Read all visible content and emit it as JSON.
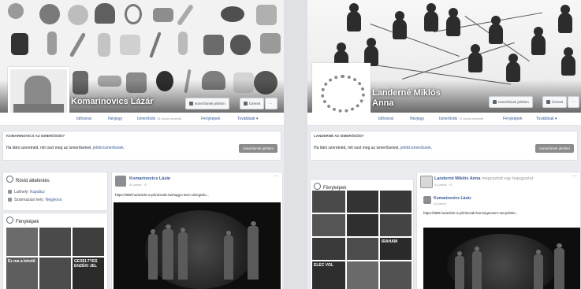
{
  "left": {
    "profile_name": "Komarinovics Lázár",
    "buttons": {
      "friend_request": "Ismerősnek jelölöm",
      "message": "Üzenet"
    },
    "nav": [
      {
        "label": "Idővonal",
        "sub": ""
      },
      {
        "label": "Névjegy",
        "sub": ""
      },
      {
        "label": "Ismerősök",
        "sub": "24 közös ismerős"
      },
      {
        "label": "Fényképek",
        "sub": ""
      },
      {
        "label": "Továbbiak ▾",
        "sub": ""
      }
    ],
    "know_card": {
      "title": "KOMARINOVICS AZ ISMERŐSÖD?",
      "text": "Ha látni szeretnéd, mit oszt meg az ismerőseivel,",
      "link": "jelöld ismerősnek.",
      "button": "Ismerősnek jelölöm"
    },
    "intro": {
      "title": "Rövid áttekintés",
      "lines": [
        {
          "label": "Lakhely:",
          "value": "Kupalicz"
        },
        {
          "label": "Származási hely:",
          "value": "Négylova"
        }
      ]
    },
    "photos": {
      "title": "Fényképek",
      "tiles": [
        {
          "text": "",
          "color": "#6b6b6b"
        },
        {
          "text": "",
          "color": "#4a4a4a"
        },
        {
          "text": "",
          "color": "#3e3e3e"
        },
        {
          "text": "Ez ma a lehető",
          "color": "#5e5e5e"
        },
        {
          "text": "",
          "color": "#4c4c4c"
        },
        {
          "text": "GESELTYES ENZÉKI JEL",
          "color": "#2b2b2b"
        }
      ]
    },
    "post": {
      "author": "Komarinovics Lázár",
      "meta": "41 perce · ⊙",
      "text": "https://888.hu/article-a-pilzinszab-tavhagyo-sten-ulengedo..."
    }
  },
  "right": {
    "profile_name": "Landerné Miklós Anna",
    "buttons": {
      "friend_request": "Ismerősnek jelölöm",
      "message": "Üzenet"
    },
    "nav": [
      {
        "label": "Idővonal",
        "sub": ""
      },
      {
        "label": "Névjegy",
        "sub": ""
      },
      {
        "label": "Ismerősök",
        "sub": "17 közös ismerős"
      },
      {
        "label": "Fényképek",
        "sub": ""
      },
      {
        "label": "Továbbiak ▾",
        "sub": ""
      }
    ],
    "know_card": {
      "title": "LANDERNÉ AZ ISMERŐSÖD?",
      "text": "Ha látni szeretnéd, mit oszt meg az ismerőseivel,",
      "link": "jelöld ismerősnek.",
      "button": "Ismerősnek jelölöm"
    },
    "photos": {
      "title": "Fényképek",
      "tiles": [
        {
          "text": "",
          "color": "#4a4a4a"
        },
        {
          "text": "",
          "color": "#333333"
        },
        {
          "text": "",
          "color": "#383838"
        },
        {
          "text": "",
          "color": "#555555"
        },
        {
          "text": "",
          "color": "#2f2f2f"
        },
        {
          "text": "",
          "color": "#444444"
        },
        {
          "text": "",
          "color": "#3a3a3a"
        },
        {
          "text": "",
          "color": "#4d4d4d"
        },
        {
          "text": "IRAHAM",
          "color": "#2a2a2a"
        },
        {
          "text": "ELEC VOL",
          "color": "#2e2e2e"
        },
        {
          "text": "",
          "color": "#6a6a6a"
        },
        {
          "text": "",
          "color": "#525252"
        }
      ]
    },
    "post": {
      "author": "Landerné Miklós Anna",
      "author_rest": " megosztott egy bejegyzést",
      "meta": "41 perce · ⊙",
      "shared_author": "Komarinovics Lázár",
      "shared_meta": "42 perce",
      "text": "https://888.hu/article-a-pilzinszab-borszigeszem-senyeleke..."
    }
  }
}
